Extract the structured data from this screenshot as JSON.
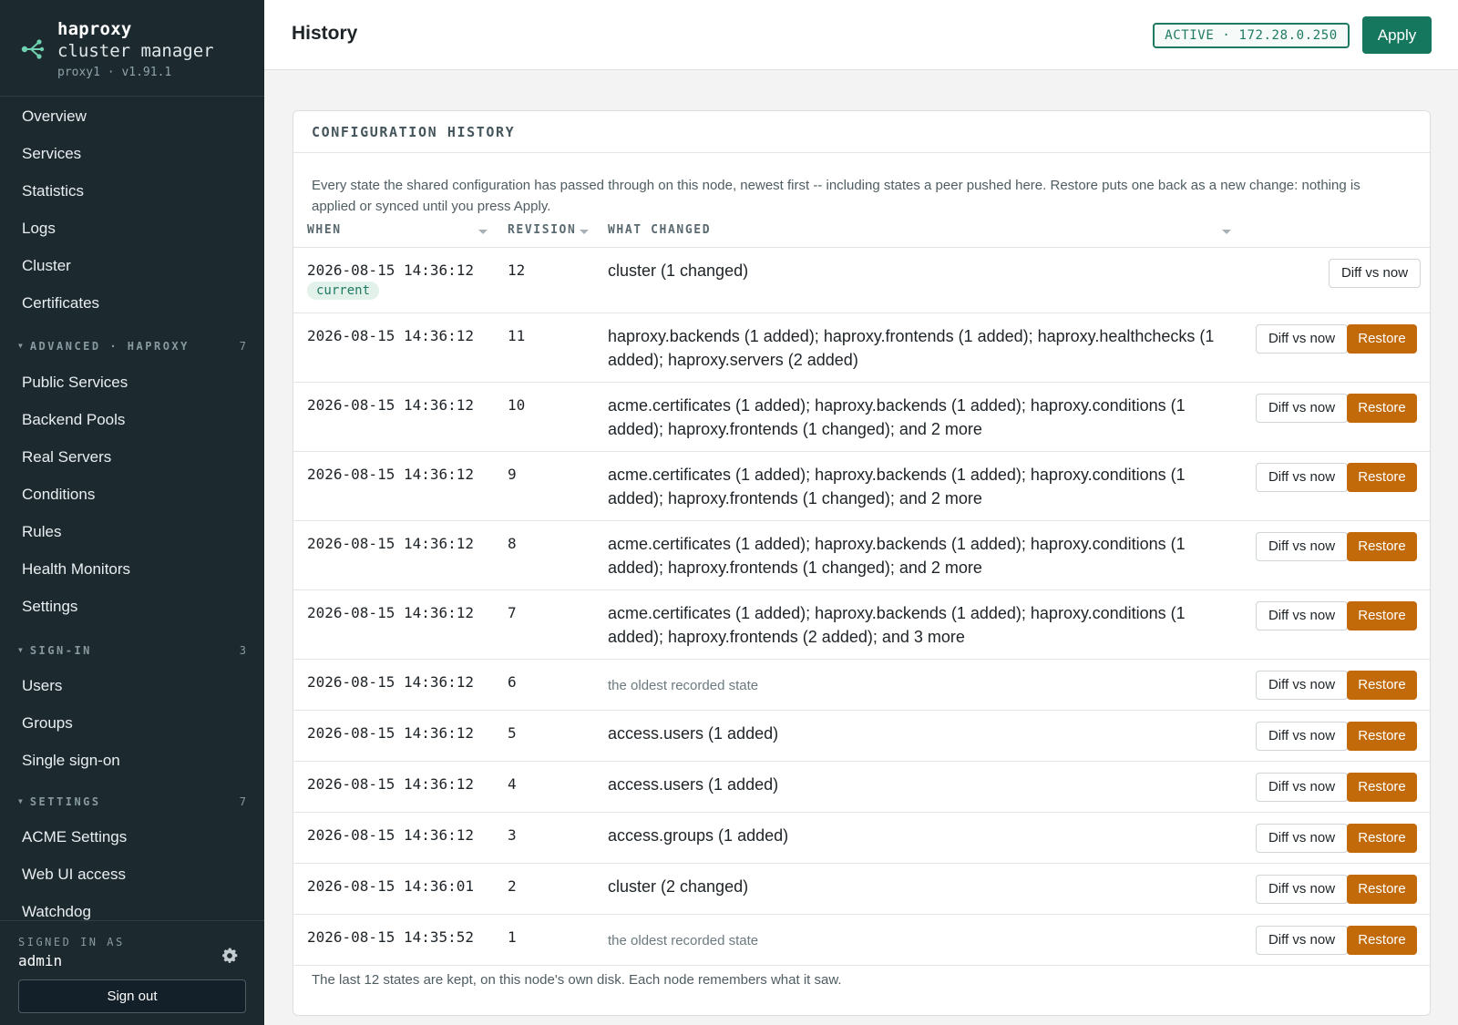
{
  "brand": {
    "name": "haproxy",
    "subtitle": "cluster manager",
    "version": "proxy1 · v1.91.1",
    "logo_icon": "share-nodes-icon"
  },
  "sidebar": {
    "top_items": [
      {
        "label": "Overview"
      },
      {
        "label": "Services"
      },
      {
        "label": "Statistics"
      },
      {
        "label": "Logs"
      },
      {
        "label": "Cluster"
      },
      {
        "label": "Certificates"
      }
    ],
    "groups": [
      {
        "title": "ADVANCED · HAPROXY",
        "count": "7",
        "items": [
          {
            "label": "Public Services"
          },
          {
            "label": "Backend Pools"
          },
          {
            "label": "Real Servers"
          },
          {
            "label": "Conditions"
          },
          {
            "label": "Rules"
          },
          {
            "label": "Health Monitors"
          },
          {
            "label": "Settings"
          }
        ]
      },
      {
        "title": "SIGN-IN",
        "count": "3",
        "items": [
          {
            "label": "Users"
          },
          {
            "label": "Groups"
          },
          {
            "label": "Single sign-on"
          }
        ]
      },
      {
        "title": "SETTINGS",
        "count": "7",
        "items": [
          {
            "label": "ACME Settings"
          },
          {
            "label": "Web UI access"
          },
          {
            "label": "Watchdog"
          }
        ]
      }
    ],
    "signed_in_label": "SIGNED IN AS",
    "user": "admin",
    "sign_out_label": "Sign out"
  },
  "header": {
    "title": "History",
    "status": "ACTIVE · 172.28.0.250",
    "apply_label": "Apply"
  },
  "panel": {
    "title": "CONFIGURATION HISTORY",
    "description": "Every state the shared configuration has passed through on this node, newest first -- including states a peer pushed here. Restore puts one back as a new change: nothing is applied or synced until you press Apply.",
    "columns": {
      "when": "WHEN",
      "revision": "REVISION",
      "what": "WHAT CHANGED"
    },
    "current_label": "current",
    "diff_label": "Diff vs now",
    "restore_label": "Restore",
    "footer": "The last 12 states are kept, on this node's own disk. Each node remembers what it saw.",
    "rows": [
      {
        "when": "2026-08-15 14:36:12",
        "revision": "12",
        "what": "cluster (1 changed)",
        "current": true,
        "muted": false
      },
      {
        "when": "2026-08-15 14:36:12",
        "revision": "11",
        "what": "haproxy.backends (1 added); haproxy.frontends (1 added); haproxy.healthchecks (1 added); haproxy.servers (2 added)",
        "current": false,
        "muted": false
      },
      {
        "when": "2026-08-15 14:36:12",
        "revision": "10",
        "what": "acme.certificates (1 added); haproxy.backends (1 added); haproxy.conditions (1 added); haproxy.frontends (1 changed); and 2 more",
        "current": false,
        "muted": false
      },
      {
        "when": "2026-08-15 14:36:12",
        "revision": "9",
        "what": "acme.certificates (1 added); haproxy.backends (1 added); haproxy.conditions (1 added); haproxy.frontends (1 changed); and 2 more",
        "current": false,
        "muted": false
      },
      {
        "when": "2026-08-15 14:36:12",
        "revision": "8",
        "what": "acme.certificates (1 added); haproxy.backends (1 added); haproxy.conditions (1 added); haproxy.frontends (1 changed); and 2 more",
        "current": false,
        "muted": false
      },
      {
        "when": "2026-08-15 14:36:12",
        "revision": "7",
        "what": "acme.certificates (1 added); haproxy.backends (1 added); haproxy.conditions (1 added); haproxy.frontends (2 added); and 3 more",
        "current": false,
        "muted": false
      },
      {
        "when": "2026-08-15 14:36:12",
        "revision": "6",
        "what": "the oldest recorded state",
        "current": false,
        "muted": true
      },
      {
        "when": "2026-08-15 14:36:12",
        "revision": "5",
        "what": "access.users (1 added)",
        "current": false,
        "muted": false
      },
      {
        "when": "2026-08-15 14:36:12",
        "revision": "4",
        "what": "access.users (1 added)",
        "current": false,
        "muted": false
      },
      {
        "when": "2026-08-15 14:36:12",
        "revision": "3",
        "what": "access.groups (1 added)",
        "current": false,
        "muted": false
      },
      {
        "when": "2026-08-15 14:36:01",
        "revision": "2",
        "what": "cluster (2 changed)",
        "current": false,
        "muted": false
      },
      {
        "when": "2026-08-15 14:35:52",
        "revision": "1",
        "what": "the oldest recorded state",
        "current": false,
        "muted": true
      }
    ]
  },
  "colors": {
    "sidebar_bg": "#1c2a30",
    "accent_green": "#16775f",
    "restore_orange": "#c26a0a"
  }
}
